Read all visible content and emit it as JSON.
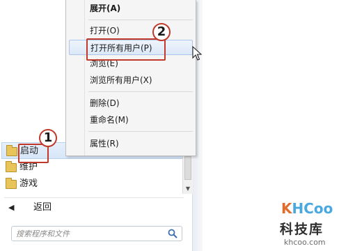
{
  "context_menu": {
    "items": [
      {
        "label": "展开(A)"
      },
      {
        "label": "打开(O)"
      },
      {
        "label": "打开所有用户(P)"
      },
      {
        "label": "浏览(E)"
      },
      {
        "label": "浏览所有用户(X)"
      },
      {
        "label": "删除(D)"
      },
      {
        "label": "重命名(M)"
      },
      {
        "label": "属性(R)"
      }
    ]
  },
  "start_menu": {
    "programs": [
      {
        "label": "启动",
        "icon": "folder-icon"
      },
      {
        "label": "维护",
        "icon": "folder-icon"
      },
      {
        "label": "游戏",
        "icon": "folder-icon"
      }
    ],
    "back_label": "返回",
    "search_placeholder": "搜索程序和文件"
  },
  "annotations": {
    "badge_1": "1",
    "badge_2": "2"
  },
  "watermark": {
    "logo_k": "K",
    "logo_h": "H",
    "logo_rest": "Coo",
    "brand_cn": "科技库",
    "domain": "khcoo.com"
  },
  "colors": {
    "highlight": "#c0392b",
    "menu_bg": "#f5f5f5",
    "selection": "#d6e6f8",
    "folder": "#e9c45a"
  }
}
